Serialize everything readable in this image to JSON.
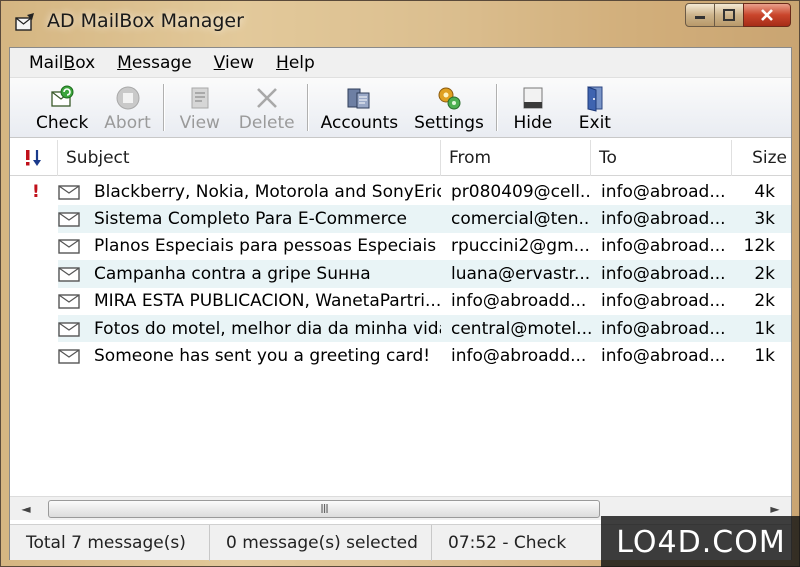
{
  "window": {
    "title": "AD MailBox Manager"
  },
  "menu": {
    "items": [
      {
        "pre": "Mail",
        "u": "B",
        "post": "ox"
      },
      {
        "pre": "",
        "u": "M",
        "post": "essage"
      },
      {
        "pre": "",
        "u": "V",
        "post": "iew"
      },
      {
        "pre": "",
        "u": "H",
        "post": "elp"
      }
    ]
  },
  "toolbar": {
    "check": "Check",
    "abort": "Abort",
    "view": "View",
    "delete": "Delete",
    "accounts": "Accounts",
    "settings": "Settings",
    "hide": "Hide",
    "exit": "Exit"
  },
  "list": {
    "headers": {
      "subject": "Subject",
      "from": "From",
      "to": "To",
      "size": "Size"
    },
    "rows": [
      {
        "priority": "!",
        "subject": "Blackberry, Nokia, Motorola and SonyErics...",
        "from": "pr080409@cell...",
        "to": "info@abroad...",
        "size": "4k"
      },
      {
        "priority": "",
        "subject": "Sistema Completo Para E-Commerce",
        "from": "comercial@ten...",
        "to": "info@abroad...",
        "size": "3k"
      },
      {
        "priority": "",
        "subject": "Planos Especiais para pessoas Especiais",
        "from": "rpuccini2@gm...",
        "to": "info@abroad...",
        "size": "12k"
      },
      {
        "priority": "",
        "subject": "Campanha contra a gripe Suнна",
        "from": "luana@ervastr...",
        "to": "info@abroad...",
        "size": "2k"
      },
      {
        "priority": "",
        "subject": "MIRA ESTA PUBLICACION, WanetaPartri...",
        "from": "info@abroadd...",
        "to": "info@abroad...",
        "size": "2k"
      },
      {
        "priority": "",
        "subject": "Fotos do motel, melhor dia da minha vida.",
        "from": "central@motel...",
        "to": "info@abroad...",
        "size": "1k"
      },
      {
        "priority": "",
        "subject": "Someone has sent you a greeting card!",
        "from": "info@abroadd...",
        "to": "info@abroad...",
        "size": "1k"
      }
    ]
  },
  "scrollbar": {
    "grip": "III"
  },
  "status": {
    "total": "Total 7 message(s)",
    "selected": "0 message(s) selected",
    "last_check": "07:52 - Check"
  },
  "watermark": {
    "text": "LO4D.COM"
  },
  "colors": {
    "priority_red": "#c0101a",
    "alt_row": "#e9f4f6",
    "accent_blue": "#1a3a8c"
  }
}
